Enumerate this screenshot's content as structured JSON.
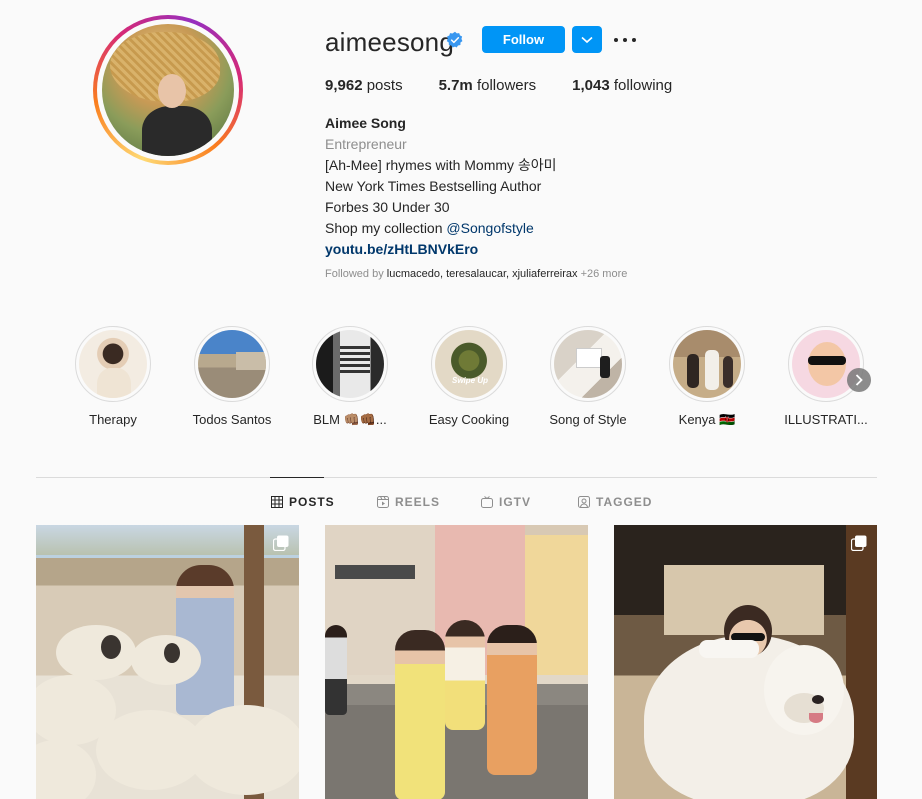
{
  "profile": {
    "username": "aimeesong",
    "follow_label": "Follow",
    "stats": {
      "posts_count": "9,962",
      "posts_label": " posts",
      "followers_count": "5.7m",
      "followers_label": " followers",
      "following_count": "1,043",
      "following_label": " following"
    },
    "bio": {
      "name": "Aimee Song",
      "category": "Entrepreneur",
      "line1": "[Ah-Mee] rhymes with Mommy 송아미",
      "line2": "New York Times Bestselling Author",
      "line3": "Forbes 30 Under 30",
      "line4_prefix": "Shop my collection ",
      "line4_mention": "@Songofstyle",
      "link": "youtu.be/zHtLBNVkEro"
    },
    "followed_by": {
      "prefix": "Followed by ",
      "users": "lucmacedo, teresalaucar, xjuliaferreirax",
      "more": " +26 more"
    }
  },
  "highlights": [
    {
      "label": "Therapy"
    },
    {
      "label": "Todos Santos"
    },
    {
      "label": "BLM 👊🏽👊🏾..."
    },
    {
      "label": "Easy Cooking"
    },
    {
      "label": "Song of Style"
    },
    {
      "label": "Kenya 🇰🇪"
    },
    {
      "label": "ILLUSTRATI..."
    }
  ],
  "tabs": [
    {
      "label": "POSTS",
      "icon": "grid-icon",
      "active": true
    },
    {
      "label": "REELS",
      "icon": "reels-icon",
      "active": false
    },
    {
      "label": "IGTV",
      "icon": "igtv-icon",
      "active": false
    },
    {
      "label": "TAGGED",
      "icon": "tagged-icon",
      "active": false
    }
  ],
  "colors": {
    "accent": "#0095f6",
    "link": "#00376b",
    "muted": "#8e8e8e",
    "text": "#262626",
    "background": "#fafafa"
  }
}
